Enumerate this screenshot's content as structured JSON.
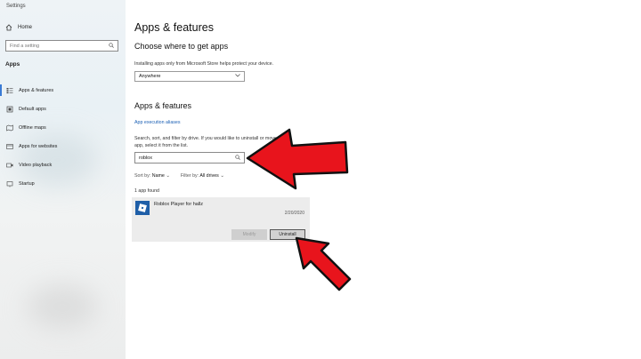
{
  "window": {
    "title": "Settings"
  },
  "sidebar": {
    "home_label": "Home",
    "search_placeholder": "Find a setting",
    "section": "Apps",
    "items": [
      {
        "label": "Apps & features",
        "icon": "apps-list-icon",
        "active": true
      },
      {
        "label": "Default apps",
        "icon": "default-apps-icon"
      },
      {
        "label": "Offline maps",
        "icon": "map-icon"
      },
      {
        "label": "Apps for websites",
        "icon": "link-icon"
      },
      {
        "label": "Video playback",
        "icon": "video-icon"
      },
      {
        "label": "Startup",
        "icon": "startup-icon"
      }
    ]
  },
  "main": {
    "title": "Apps & features",
    "choose": {
      "heading": "Choose where to get apps",
      "description": "Installing apps only from Microsoft Store helps protect your device.",
      "dropdown_value": "Anywhere"
    },
    "apps": {
      "heading": "Apps & features",
      "link": "App execution aliases",
      "search_description_1": "Search, sort, and filter by drive. If you would like to uninstall or move an",
      "search_description_2": "app, select it from the list.",
      "search_value": "roblox",
      "sort_label": "Sort by:",
      "sort_value": "Name",
      "filter_label": "Filter by:",
      "filter_value": "All drives",
      "count_text": "1 app found",
      "app_name": "Roblox Player for hallz",
      "app_date": "2/20/2020",
      "modify_label": "Modify",
      "uninstall_label": "Uninstall"
    }
  },
  "colors": {
    "accent": "#3a7bd5",
    "annotation_arrow": "#e8141c"
  }
}
